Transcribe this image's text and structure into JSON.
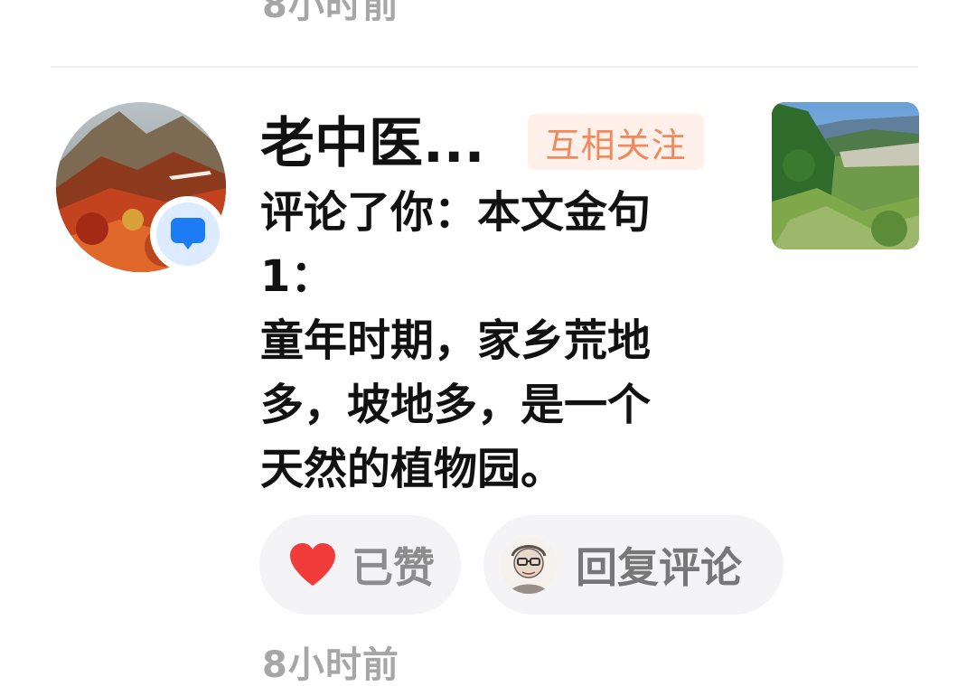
{
  "notification": {
    "prev_time": "8小时前",
    "username": "老中医...",
    "relation_tag": "互相关注",
    "comment_text": "评论了你：本文金句\n1：\n童年时期，家乡荒地\n多，坡地多，是一个\n天然的植物园。",
    "like_label": "已赞",
    "reply_label": "回复评论",
    "time": "8小时前"
  },
  "colors": {
    "accent_follow_text": "#f08a5d",
    "accent_follow_bg": "#fff1ea",
    "like_heart": "#f23b3b",
    "badge_blue": "#1b7cf5",
    "muted_text": "#a6a6a6"
  },
  "icons": {
    "comment_badge": "comment-bubble-icon",
    "like": "heart-icon"
  }
}
